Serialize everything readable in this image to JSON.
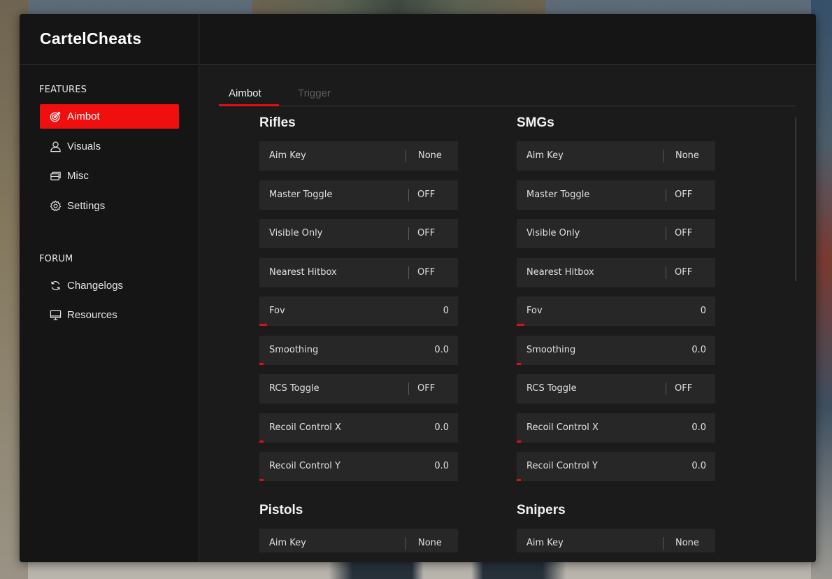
{
  "app": {
    "title": "CartelCheats"
  },
  "colors": {
    "accent": "#ef0f0f",
    "panel": "#1b1b1b",
    "row": "#272727"
  },
  "sidebar": {
    "sections": [
      {
        "label": "FEATURES",
        "items": [
          {
            "label": "Aimbot",
            "icon": "target-icon",
            "active": true
          },
          {
            "label": "Visuals",
            "icon": "user-icon",
            "active": false
          },
          {
            "label": "Misc",
            "icon": "layers-icon",
            "active": false
          },
          {
            "label": "Settings",
            "icon": "gear-icon",
            "active": false
          }
        ]
      },
      {
        "label": "FORUM",
        "items": [
          {
            "label": "Changelogs",
            "icon": "refresh-icon",
            "active": false
          },
          {
            "label": "Resources",
            "icon": "monitor-icon",
            "active": false
          }
        ]
      }
    ]
  },
  "tabs": [
    {
      "label": "Aimbot",
      "active": true
    },
    {
      "label": "Trigger",
      "active": false
    }
  ],
  "groups": [
    {
      "title": "Rifles",
      "rows": [
        {
          "label": "Aim Key",
          "type": "toggle",
          "value": "None"
        },
        {
          "label": "Master Toggle",
          "type": "toggle",
          "value": "OFF"
        },
        {
          "label": "Visible Only",
          "type": "toggle",
          "value": "OFF"
        },
        {
          "label": "Nearest Hitbox",
          "type": "toggle",
          "value": "OFF"
        },
        {
          "label": "Fov",
          "type": "slider",
          "value": "0",
          "fill": 0.04
        },
        {
          "label": "Smoothing",
          "type": "slider",
          "value": "0.0",
          "fill": 0.02
        },
        {
          "label": "RCS Toggle",
          "type": "toggle",
          "value": "OFF"
        },
        {
          "label": "Recoil Control X",
          "type": "slider",
          "value": "0.0",
          "fill": 0.02
        },
        {
          "label": "Recoil Control Y",
          "type": "slider",
          "value": "0.0",
          "fill": 0.02
        }
      ]
    },
    {
      "title": "SMGs",
      "rows": [
        {
          "label": "Aim Key",
          "type": "toggle",
          "value": "None"
        },
        {
          "label": "Master Toggle",
          "type": "toggle",
          "value": "OFF"
        },
        {
          "label": "Visible Only",
          "type": "toggle",
          "value": "OFF"
        },
        {
          "label": "Nearest Hitbox",
          "type": "toggle",
          "value": "OFF"
        },
        {
          "label": "Fov",
          "type": "slider",
          "value": "0",
          "fill": 0.04
        },
        {
          "label": "Smoothing",
          "type": "slider",
          "value": "0.0",
          "fill": 0.02
        },
        {
          "label": "RCS Toggle",
          "type": "toggle",
          "value": "OFF"
        },
        {
          "label": "Recoil Control X",
          "type": "slider",
          "value": "0.0",
          "fill": 0.02
        },
        {
          "label": "Recoil Control Y",
          "type": "slider",
          "value": "0.0",
          "fill": 0.02
        }
      ]
    },
    {
      "title": "Pistols",
      "rows": [
        {
          "label": "Aim Key",
          "type": "toggle",
          "value": "None"
        }
      ]
    },
    {
      "title": "Snipers",
      "rows": [
        {
          "label": "Aim Key",
          "type": "toggle",
          "value": "None"
        }
      ]
    }
  ]
}
